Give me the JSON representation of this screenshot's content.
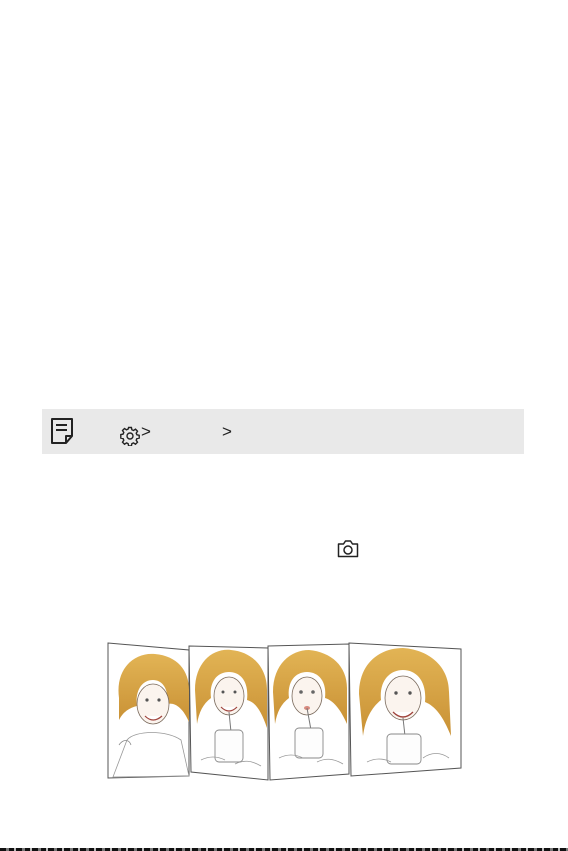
{
  "note": {
    "icon": "note-icon",
    "path_icon": "gear-icon",
    "separator": ">",
    "box_color": "#e9e9e9"
  },
  "camera": {
    "icon": "camera-icon"
  },
  "illustration": {
    "panels": [
      {
        "name": "girl-smiling-sketch"
      },
      {
        "name": "girl-drinking-straw-sketch"
      },
      {
        "name": "girl-sipping-straw-sketch"
      },
      {
        "name": "girl-holding-cup-sketch"
      }
    ],
    "hair_color": "#d9a441"
  }
}
